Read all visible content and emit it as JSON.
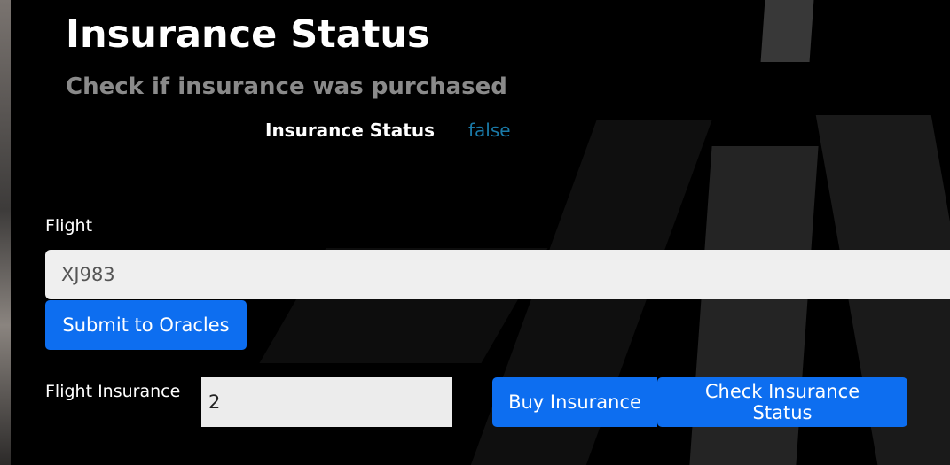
{
  "header": {
    "title": "Insurance Status",
    "subtitle": "Check if insurance was purchased"
  },
  "status": {
    "label": "Insurance Status",
    "value": "false"
  },
  "flight_form": {
    "label": "Flight",
    "value": "XJ983",
    "submit_label": "Submit to Oracles"
  },
  "insurance_form": {
    "label": "Flight Insurance",
    "value": "2",
    "buy_label": "Buy Insurance",
    "check_label": "Check Insurance Status"
  },
  "colors": {
    "primary_button": "#0d6ef0",
    "status_value": "#1a7aa8",
    "subtitle": "#8a8a8a"
  }
}
